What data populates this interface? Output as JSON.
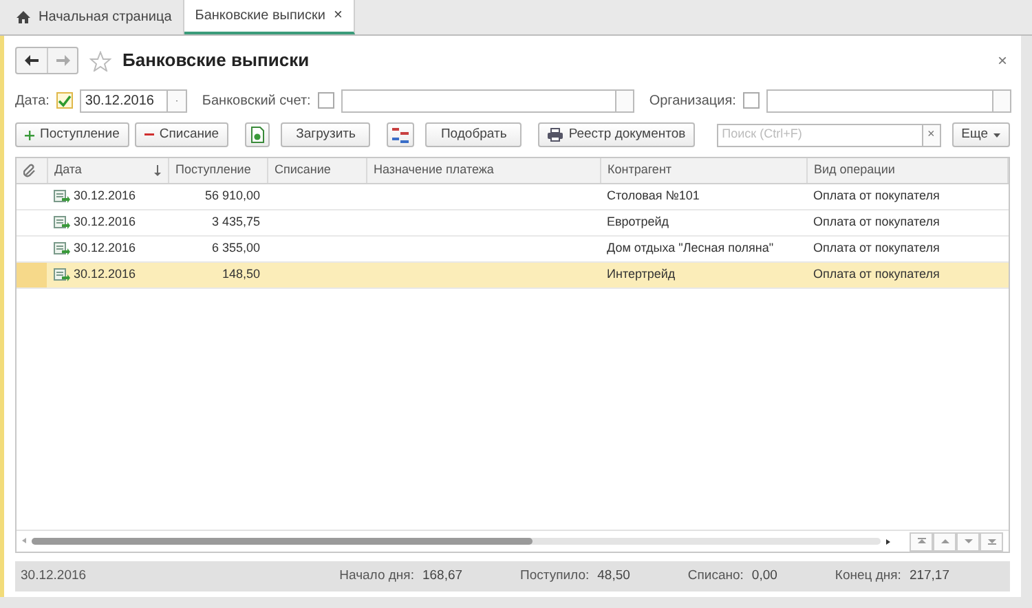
{
  "tabs": [
    {
      "label": "Начальная страница",
      "kind": "home",
      "selected": false
    },
    {
      "label": "Банковские выписки",
      "kind": "doc",
      "selected": true,
      "close": "×"
    }
  ],
  "form": {
    "title": "Банковские выписки",
    "close": "×"
  },
  "filters": [
    {
      "label": "Дата:",
      "checked": true,
      "value": "30.12.2016",
      "kind": "date"
    },
    {
      "label": "Банковский счет:",
      "checked": false,
      "kind": "select"
    },
    {
      "label": "Организация:",
      "checked": false,
      "kind": "select"
    }
  ],
  "toolbar": [
    {
      "kind": "plus",
      "label": "Поступление"
    },
    {
      "kind": "minus",
      "label": "Списание"
    },
    {
      "kind": "doc-icon"
    },
    {
      "kind": "text",
      "label": "Загрузить"
    },
    {
      "kind": "dtkt-icon"
    },
    {
      "kind": "text",
      "label": "Подобрать"
    },
    {
      "kind": "print",
      "label": "Реестр документов"
    }
  ],
  "search": {
    "placeholder": "Поиск (Ctrl+F)",
    "clear": "×"
  },
  "more": {
    "label": "Еще"
  },
  "table": {
    "columns": [
      "Дата",
      "Поступление",
      "Списание",
      "Назначение платежа",
      "Контрагент",
      "Вид операции"
    ],
    "rows": [
      {
        "date": "30.12.2016",
        "income": "56 910,00",
        "counterparty": "Столовая №101",
        "operation": "Оплата от покупателя",
        "selected": false
      },
      {
        "date": "30.12.2016",
        "income": "3 435,75",
        "counterparty": "Евротрейд",
        "operation": "Оплата от покупателя",
        "selected": false
      },
      {
        "date": "30.12.2016",
        "income": "6 355,00",
        "counterparty": "Дом отдыха \"Лесная поляна\"",
        "operation": "Оплата от покупателя",
        "selected": false
      },
      {
        "date": "30.12.2016",
        "income": "148,50",
        "counterparty": "Интертрейд",
        "operation": "Оплата от покупателя",
        "selected": true
      }
    ]
  },
  "status_bar": {
    "date": "30.12.2016",
    "totals": [
      {
        "label": "Начало дня:",
        "value": "168,67"
      },
      {
        "label": "Поступило:",
        "value": "48,50"
      },
      {
        "label": "Списано:",
        "value": "0,00"
      },
      {
        "label": "Конец дня:",
        "value": "217,17"
      }
    ]
  }
}
